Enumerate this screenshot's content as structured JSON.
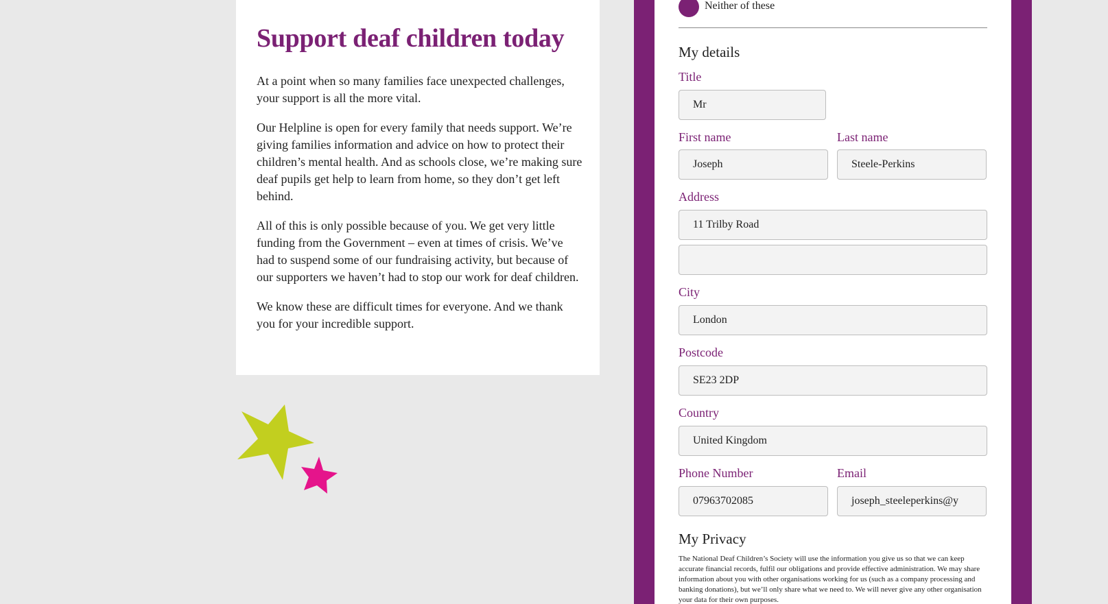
{
  "intro": {
    "title": "Support deaf children today",
    "paragraphs": [
      "At a point when so many families face unexpected challenges, your support is all the more vital.",
      "Our Helpline is open for every family that needs support. We’re giving families information and advice on how to protect their children’s mental health. And as schools close, we’re making sure deaf pupils get help to learn from home, so they don’t get left behind.",
      "All of this is only possible because of you. We get very little funding from the Government – even at times of crisis. We’ve had to suspend some of our fundraising activity, but because of our supporters we haven’t had to stop our work for deaf children.",
      "We know these are difficult times for everyone. And we thank you for your incredible support."
    ]
  },
  "form": {
    "radio_option": "Neither of these",
    "my_details_heading": "My details",
    "title_label": "Title",
    "title_value": "Mr",
    "first_name_label": "First name",
    "first_name_value": "Joseph",
    "last_name_label": "Last name",
    "last_name_value": "Steele-Perkins",
    "address_label": "Address",
    "address_line1_value": "11 Trilby Road",
    "address_line2_value": "",
    "city_label": "City",
    "city_value": "London",
    "postcode_label": "Postcode",
    "postcode_value": "SE23 2DP",
    "country_label": "Country",
    "country_value": "United Kingdom",
    "phone_label": "Phone Number",
    "phone_value": "07963702085",
    "email_label": "Email",
    "email_value": "joseph_steeleperkins@y",
    "privacy_heading": "My Privacy",
    "privacy_text": "The National Deaf Children’s Society will use the information you give us so that we can keep accurate financial records, fulfil our obligations and provide effective administration. We may share information about you with other organisations working for us (such as a company processing and banking donations), but we’ll only share what we need to. We will never give any other organisation your data for their own purposes."
  },
  "colors": {
    "brand_purple": "#7b2174",
    "star_lime": "#c2cf1f",
    "star_magenta": "#e5148b",
    "background": "#e9e9e9"
  },
  "icons": [
    "lime-star-icon",
    "magenta-star-icon",
    "radio-selected-icon"
  ]
}
